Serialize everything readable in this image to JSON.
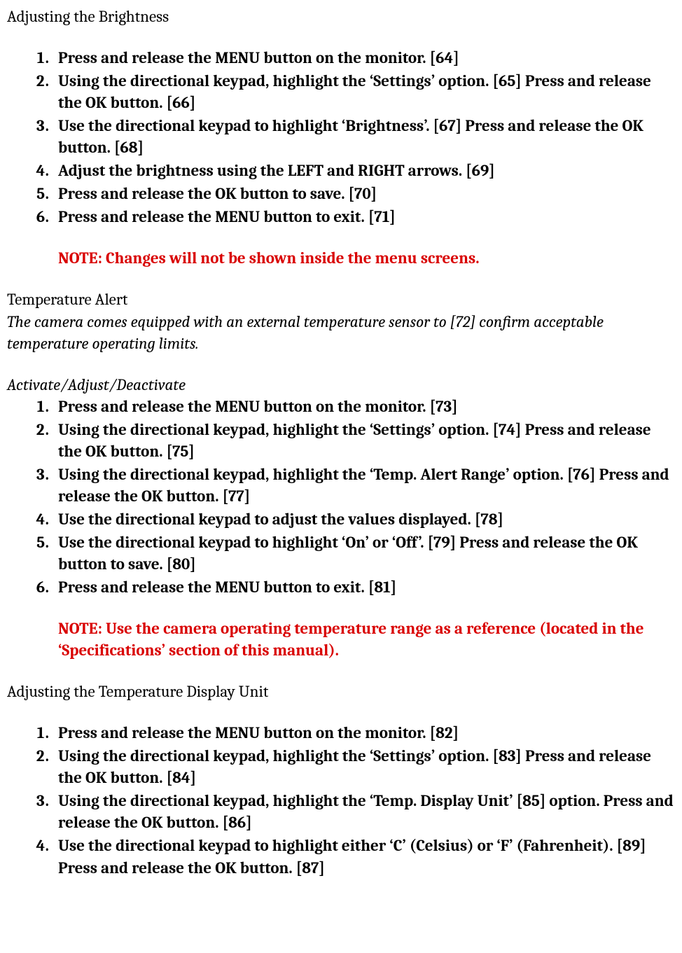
{
  "section1": {
    "heading": "Adjusting the Brightness",
    "steps": [
      "Press and release the MENU button on the monitor. [64]",
      "Using the directional keypad, highlight the ‘Settings’ option. [65] Press and release the OK button.  [66]",
      "Use the directional keypad to highlight ‘Brightness’. [67] Press and release the OK button. [68]",
      "Adjust the brightness using the LEFT and RIGHT arrows. [69]",
      "Press and release the OK button to save. [70]",
      "Press and release the MENU button to exit. [71]"
    ],
    "note": "NOTE: Changes will not be shown inside the menu screens."
  },
  "section2": {
    "heading": "Temperature Alert",
    "desc": "The camera comes equipped with an external temperature sensor to [72] confirm acceptable temperature operating limits.",
    "subheading": "Activate/Adjust/Deactivate",
    "steps": [
      "Press and release the MENU button on the monitor. [73]",
      "Using the directional keypad, highlight the ‘Settings’ option. [74] Press and release the OK button. [75]",
      "Using the directional keypad, highlight the ‘Temp. Alert Range’ option. [76] Press and release the OK button. [77]",
      "Use the directional keypad to adjust the values displayed. [78]",
      "Use the directional keypad to highlight ‘On’ or ‘Off’. [79] Press and release the OK button to save. [80]",
      "Press and release the MENU button to exit. [81]"
    ],
    "note": "NOTE: Use the camera operating temperature range as a reference (located in the ‘Specifications’ section of this manual)."
  },
  "section3": {
    "heading": "Adjusting the Temperature Display Unit",
    "steps": [
      "Press and release the MENU button on the monitor. [82]",
      "Using the directional keypad, highlight the ‘Settings’ option. [83] Press and release the OK button. [84]",
      "Using the directional keypad, highlight the ‘Temp. Display Unit’ [85] option. Press and release the OK button. [86]",
      "Use the directional keypad to highlight either ‘C’ (Celsius) or ‘F’ (Fahrenheit). [89] Press and release the OK button. [87]"
    ]
  }
}
